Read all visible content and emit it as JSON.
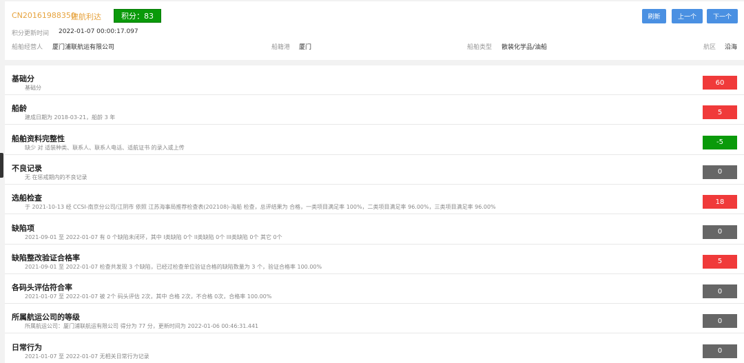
{
  "header": {
    "ship_id": "CN20161988350",
    "ship_name": "建航利达",
    "score_label": "积分：83",
    "buttons": {
      "refresh": "刷新",
      "prev": "上一个",
      "next": "下一个"
    },
    "update_time_label": "积分更新时间",
    "update_time_value": "2022-01-07 00:00:17.097",
    "operator_label": "船舶经营人",
    "operator_value": "厦门浦联航运有限公司",
    "port_label": "船籍港",
    "port_value": "厦门",
    "type_label": "船舶类型",
    "type_value": "散装化学品/油船",
    "area_label": "航区",
    "area_value": "沿海"
  },
  "colors": {
    "red": "#f03a3a",
    "green": "#0a9a0a",
    "gray": "#666666",
    "blue": "#4a90e2",
    "orange": "#e6a23c"
  },
  "rows": [
    {
      "title": "基础分",
      "desc": "基础分",
      "score": "60",
      "color": "red"
    },
    {
      "title": "船龄",
      "desc": "建成日期为 2018-03-21，船龄 3 年",
      "score": "5",
      "color": "red"
    },
    {
      "title": "船舶资料完整性",
      "desc": "缺少 对 适装种类、联系人、联系人电话、适航证书 的录入或上传",
      "score": "-5",
      "color": "green"
    },
    {
      "title": "不良记录",
      "desc": "无 在惩戒期内的不良记录",
      "score": "0",
      "color": "gray"
    },
    {
      "title": "选船检查",
      "desc": "于 2021-10-13 经 CCSI-南京分公司/江阴市 依照 江苏海事局推荐检查表(202108)-海船 检查，总评结果为 合格，一类项目满足率 100%，二类项目满足率 96.00%，三类项目满足率 96.00%",
      "score": "18",
      "color": "red"
    },
    {
      "title": "缺陷项",
      "desc": "2021-09-01 至 2022-01-07 有 0 个缺陷未闭环，其中 I类缺陷 0个 II类缺陷 0个 III类缺陷 0个 其它 0个",
      "score": "0",
      "color": "gray"
    },
    {
      "title": "缺陷整改验证合格率",
      "desc": "2021-09-01 至 2022-01-07 检查共发现 3 个缺陷，已经过检查单位验证合格的缺陷数量为 3 个，验证合格率 100.00%",
      "score": "5",
      "color": "red"
    },
    {
      "title": "各码头评估符合率",
      "desc": "2021-01-07 至 2022-01-07 被 2个 码头评估 2次，其中 合格 2次，不合格 0次，合格率 100.00%",
      "score": "0",
      "color": "gray"
    },
    {
      "title": "所属航运公司的等级",
      "desc": "所属航运公司：厦门浦联航运有限公司 得分为 77 分，更新时间为 2022-01-06 00:46:31.441",
      "score": "0",
      "color": "gray"
    },
    {
      "title": "日常行为",
      "desc": "2021-01-07 至 2022-01-07 无相关日常行为记录",
      "score": "0",
      "color": "gray"
    }
  ]
}
